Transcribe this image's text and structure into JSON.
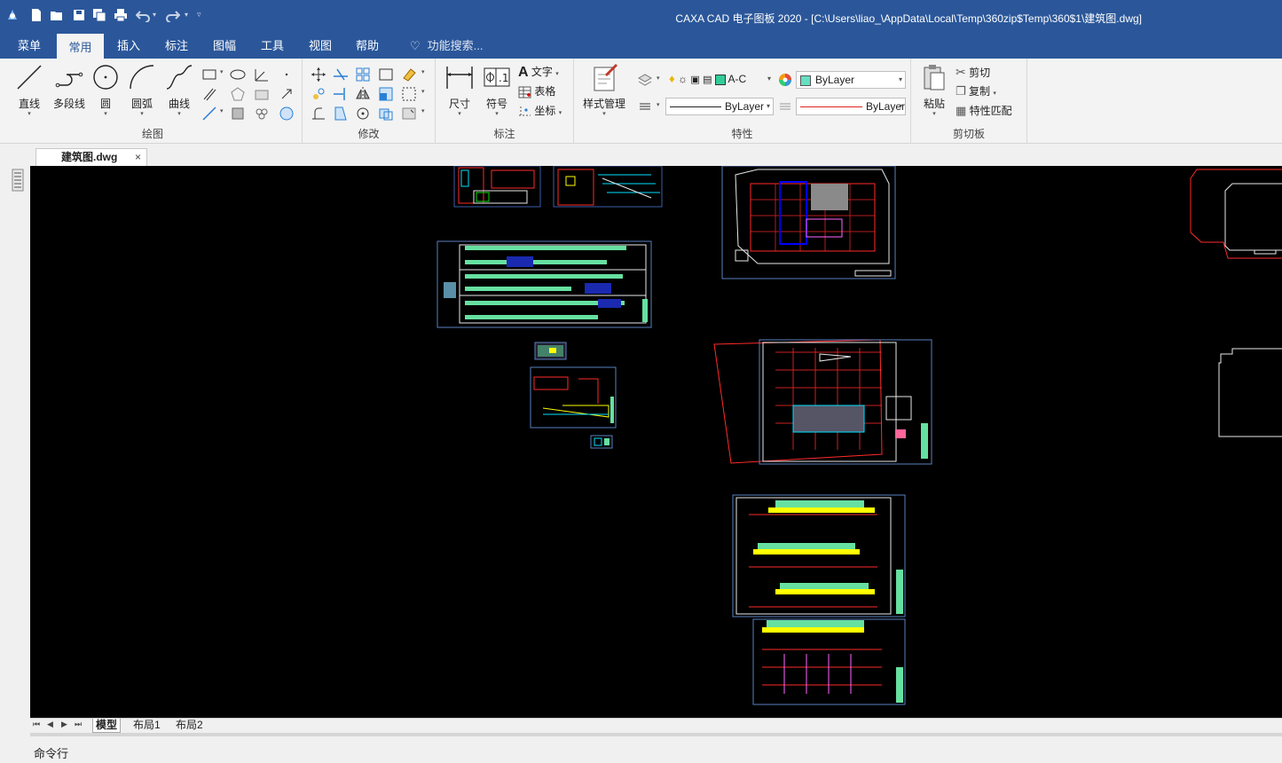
{
  "window": {
    "title": "CAXA CAD 电子图板 2020 - [C:\\Users\\liao_\\AppData\\Local\\Temp\\360zip$Temp\\360$1\\建筑图.dwg]",
    "titlebar_color": "#2b579a"
  },
  "quick_access": {
    "icons": [
      "new-file-icon",
      "open-folder-icon",
      "save-icon",
      "save-all-icon",
      "print-icon",
      "undo-icon",
      "redo-icon",
      "customize-icon"
    ]
  },
  "menu": {
    "tabs": [
      "菜单",
      "常用",
      "插入",
      "标注",
      "图幅",
      "工具",
      "视图",
      "帮助"
    ],
    "active": "常用",
    "search_placeholder": "功能搜索..."
  },
  "ribbon": {
    "draw": {
      "label": "绘图",
      "line": "直线",
      "polyline": "多段线",
      "circle": "圆",
      "arc": "圆弧",
      "curve": "曲线"
    },
    "modify": {
      "label": "修改"
    },
    "annotate": {
      "label": "标注",
      "dimension": "尺寸",
      "symbol": "符号",
      "text": "文字",
      "table": "表格",
      "coordinate": "坐标"
    },
    "properties": {
      "label": "特性",
      "style_manager": "样式管理",
      "layer_name": "A-C",
      "color_value": "ByLayer",
      "linetype_value": "ByLayer",
      "lineweight_value": "ByLayer",
      "layer_swatch_color": "#33cc99",
      "color_swatch_color": "#66e0c0",
      "lineweight_color": "#e02020"
    },
    "clipboard": {
      "label": "剪切板",
      "paste": "粘贴",
      "cut": "剪切",
      "copy": "复制",
      "match_props": "特性匹配"
    }
  },
  "document": {
    "tab_name": "建筑图.dwg",
    "close_glyph": "×"
  },
  "layouts": {
    "tabs": [
      "模型",
      "布局1",
      "布局2"
    ],
    "active": "模型",
    "nav_glyphs": [
      "⏮",
      "◀",
      "▶",
      "⏭"
    ]
  },
  "command": {
    "label": "命令行"
  },
  "canvas": {
    "background": "#000000"
  }
}
